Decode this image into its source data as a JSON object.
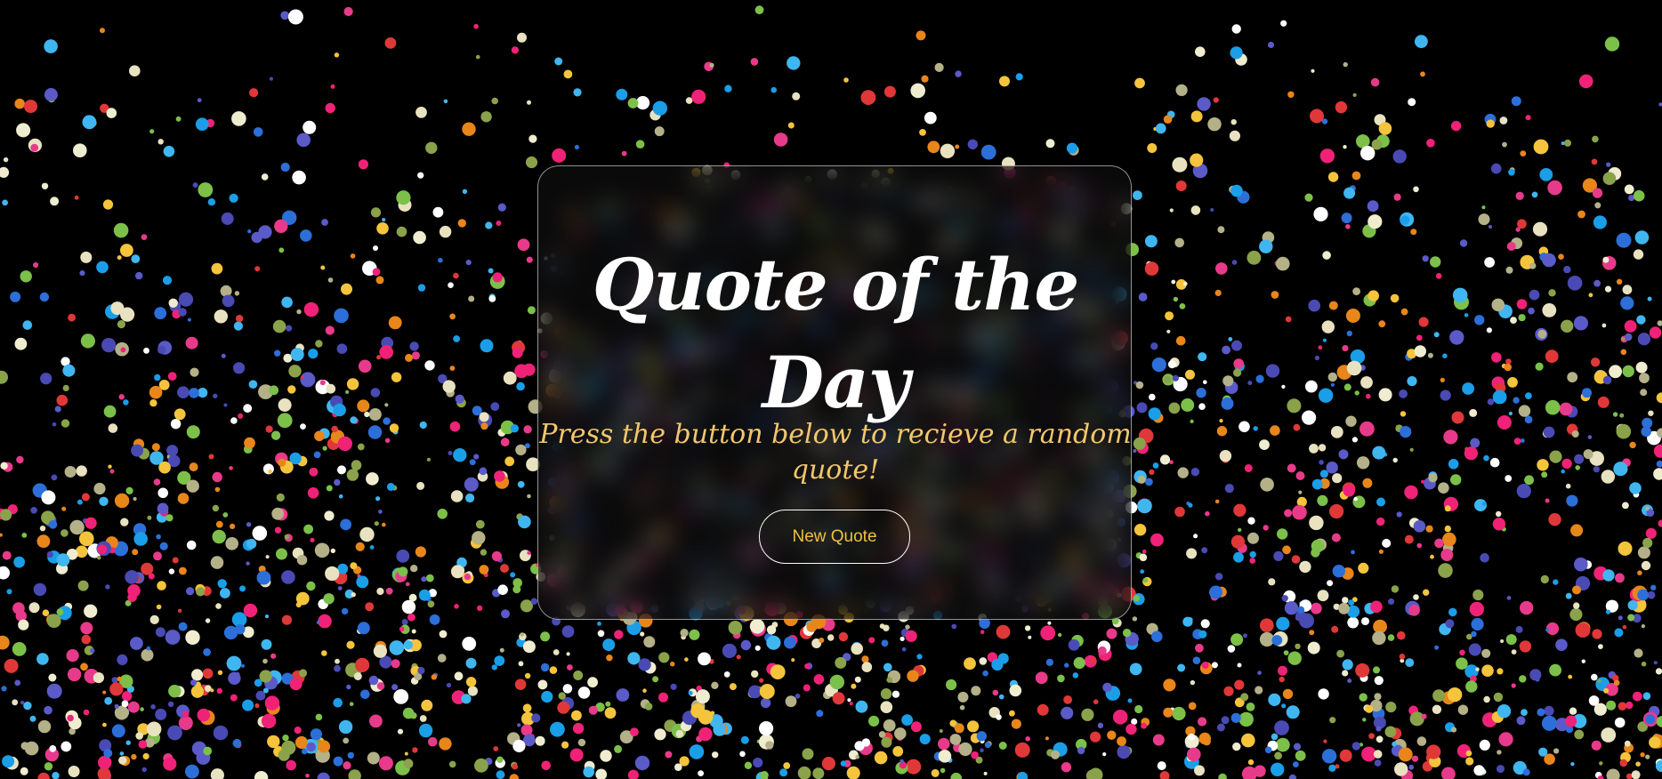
{
  "card": {
    "title": "Quote of the Day",
    "subtitle": "Press the button below to recieve a random quote!",
    "button_label": "New Quote"
  },
  "background": {
    "color": "#000000",
    "confetti_colors": [
      "#ffffff",
      "#f0ecd0",
      "#e8e2c0",
      "#2c6fd8",
      "#3fb6f0",
      "#1a9ee8",
      "#e83a8a",
      "#f02278",
      "#e03838",
      "#e8861a",
      "#f4c43c",
      "#7cc04a",
      "#8aa24a",
      "#b4b088",
      "#5a5ac8",
      "#4a4ab4"
    ]
  },
  "theme": {
    "title_color": "#ffffff",
    "subtitle_color": "#f2c76b",
    "button_text_color": "#f2c040",
    "card_border_color": "#ffffff"
  }
}
